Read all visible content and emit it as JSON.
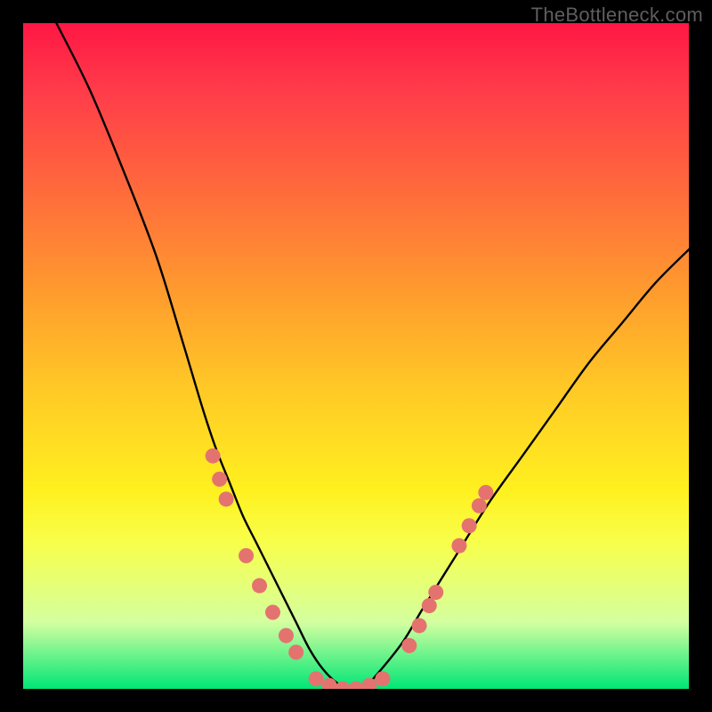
{
  "watermark": "TheBottleneck.com",
  "colors": {
    "page_bg": "#000000",
    "curve": "#000000",
    "marker_fill": "#e4736f",
    "marker_stroke": "#e4736f",
    "gradient_top": "#ff1744",
    "gradient_bottom": "#00e676"
  },
  "chart_data": {
    "type": "line",
    "title": "",
    "xlabel": "",
    "ylabel": "",
    "xlim": [
      0,
      100
    ],
    "ylim": [
      0,
      100
    ],
    "grid": false,
    "legend": false,
    "note": "Values are read in plot-area percent units; x left→right 0–100, y bottom→top 0–100.",
    "series": [
      {
        "name": "bottleneck-curve",
        "x": [
          5,
          10,
          15,
          20,
          24,
          27,
          29,
          31,
          33,
          35,
          37,
          39,
          41,
          43,
          45,
          47,
          49,
          51,
          53,
          57,
          60,
          65,
          70,
          75,
          80,
          85,
          90,
          95,
          100
        ],
        "y": [
          100,
          90,
          78,
          65,
          52,
          42,
          36,
          31,
          26,
          22,
          18,
          14,
          10,
          6,
          3,
          1,
          0,
          0,
          2,
          7,
          12,
          20,
          28,
          35,
          42,
          49,
          55,
          61,
          66
        ]
      }
    ],
    "markers": [
      {
        "x": 28.5,
        "y": 35.0
      },
      {
        "x": 29.5,
        "y": 31.5
      },
      {
        "x": 30.5,
        "y": 28.5
      },
      {
        "x": 33.5,
        "y": 20.0
      },
      {
        "x": 35.5,
        "y": 15.5
      },
      {
        "x": 37.5,
        "y": 11.5
      },
      {
        "x": 39.5,
        "y": 8.0
      },
      {
        "x": 41.0,
        "y": 5.5
      },
      {
        "x": 44.0,
        "y": 1.5
      },
      {
        "x": 46.0,
        "y": 0.5
      },
      {
        "x": 48.0,
        "y": 0.0
      },
      {
        "x": 50.0,
        "y": 0.0
      },
      {
        "x": 52.0,
        "y": 0.5
      },
      {
        "x": 54.0,
        "y": 1.5
      },
      {
        "x": 58.0,
        "y": 6.5
      },
      {
        "x": 59.5,
        "y": 9.5
      },
      {
        "x": 61.0,
        "y": 12.5
      },
      {
        "x": 62.0,
        "y": 14.5
      },
      {
        "x": 65.5,
        "y": 21.5
      },
      {
        "x": 67.0,
        "y": 24.5
      },
      {
        "x": 68.5,
        "y": 27.5
      },
      {
        "x": 69.5,
        "y": 29.5
      }
    ]
  }
}
